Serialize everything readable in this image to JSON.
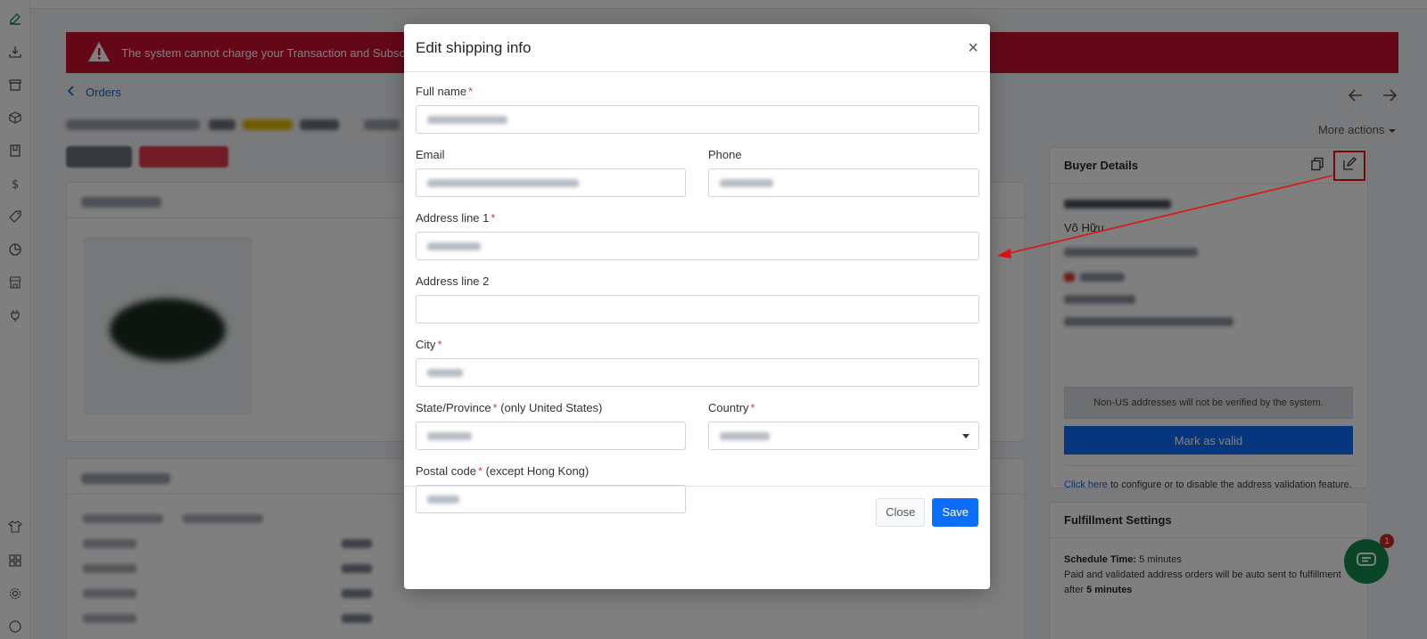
{
  "colors": {
    "alert": "#c8102e",
    "primary": "#0d6efd",
    "link": "#1565c0",
    "required": "#dc3545",
    "annotation": "#e11111",
    "chat": "#118c4f"
  },
  "alert": {
    "icon": "warning-triangle-icon",
    "text": "The system cannot charge your Transaction and Subsc"
  },
  "breadcrumb": {
    "icon": "chevron-left-icon",
    "label": "Orders"
  },
  "header": {
    "more_actions": "More actions",
    "prev_icon": "arrow-left-icon",
    "next_icon": "arrow-right-icon"
  },
  "buyer": {
    "title": "Buyer Details",
    "copy_icon": "copy-icon",
    "edit_icon": "edit-icon",
    "address_partial": "Võ  Hữu",
    "verify_note": "Non-US addresses will not be verified by the system.",
    "mark_valid": "Mark as valid",
    "config_link": "Click here",
    "config_text": " to configure or to disable the address validation feature."
  },
  "fulfillment": {
    "title": "Fulfillment Settings",
    "schedule_label": "Schedule Time:",
    "schedule_value": " 5 minutes",
    "desc": "Paid and validated address orders will be auto sent to fulfillment after ",
    "desc_strong": "5 minutes"
  },
  "chat": {
    "badge": "1",
    "icon": "chat-icon"
  },
  "modal": {
    "title": "Edit shipping info",
    "close_icon": "×",
    "fields": {
      "full_name": {
        "label": "Full name",
        "required": "*"
      },
      "email": {
        "label": "Email"
      },
      "phone": {
        "label": "Phone"
      },
      "address1": {
        "label": "Address line 1",
        "required": "*"
      },
      "address2": {
        "label": "Address line 2"
      },
      "city": {
        "label": "City",
        "required": "*"
      },
      "state": {
        "label": "State/Province",
        "required": "*",
        "hint": " (only United States)"
      },
      "country": {
        "label": "Country",
        "required": "*"
      },
      "postal": {
        "label": "Postal code",
        "required": "*",
        "hint": " (except Hong Kong)"
      }
    },
    "close_btn": "Close",
    "save_btn": "Save"
  }
}
